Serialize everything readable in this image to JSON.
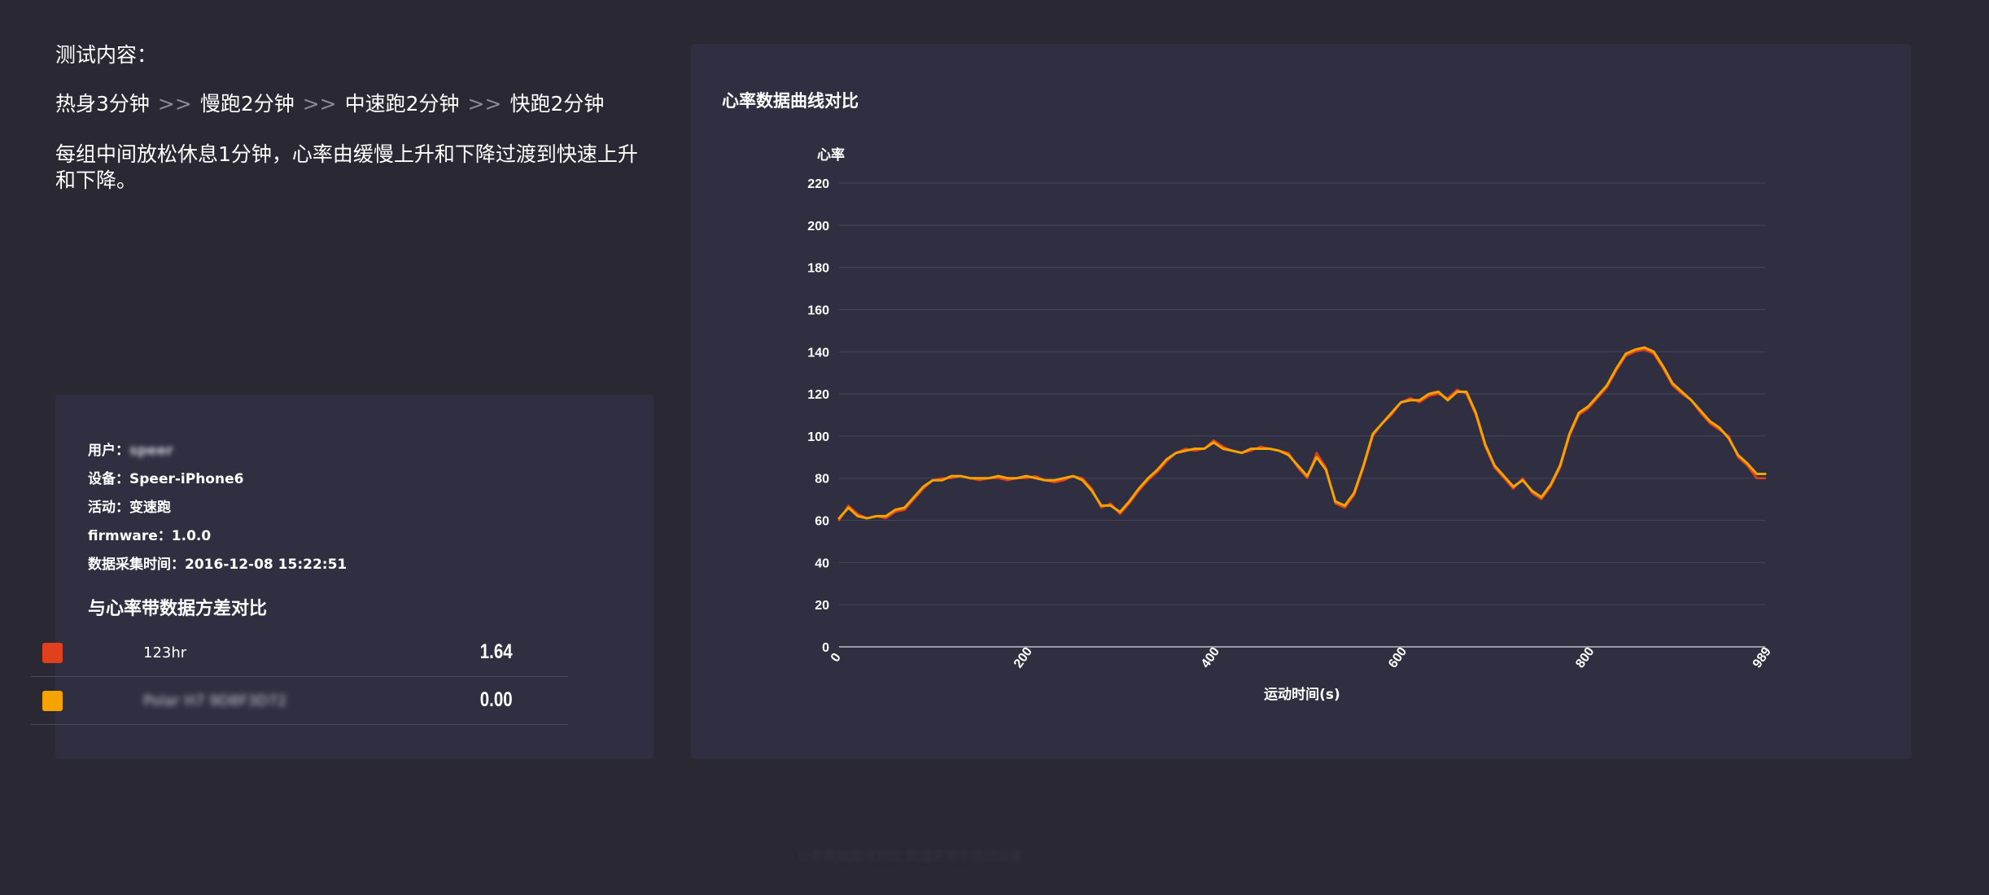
{
  "intro": {
    "title": "测试内容：",
    "steps": [
      "热身3分钟",
      "慢跑2分钟",
      "中速跑2分钟",
      "快跑2分钟"
    ],
    "separator": ">>",
    "description": "每组中间放松休息1分钟，心率由缓慢上升和下降过渡到快速上升和下降。"
  },
  "info": {
    "user_label": "用户：",
    "user_value": "speer",
    "device_label": "设备：",
    "device_value": "Speer-iPhone6",
    "activity_label": "活动：",
    "activity_value": "变速跑",
    "firmware_label": "firmware：",
    "firmware_value": "1.0.0",
    "time_label": "数据采集时间：",
    "time_value": "2016-12-08 15:22:51"
  },
  "comparison": {
    "title": "与心率带数据方差对比",
    "rows": [
      {
        "name": "123hr",
        "value": "1.64",
        "color": "#e0401c",
        "name_blurred": false
      },
      {
        "name": "Polar H7 9D8F3D72",
        "value": "0.00",
        "color": "#f5a300",
        "name_blurred": true
      }
    ]
  },
  "footer_text": "心率数据曲线对比 数据来源于测试设备",
  "chart_data": {
    "type": "line",
    "title": "心率数据曲线对比",
    "xlabel": "运动时间(s)",
    "ylabel": "心率",
    "xlim": [
      0,
      989
    ],
    "ylim": [
      0,
      220
    ],
    "x_ticks": [
      0,
      200,
      400,
      600,
      800,
      989
    ],
    "y_ticks": [
      0,
      20,
      40,
      60,
      80,
      100,
      120,
      140,
      160,
      180,
      200,
      220
    ],
    "grid": true,
    "legend": "none",
    "series": [
      {
        "name": "123hr",
        "color": "#e0401c",
        "x": [
          0,
          10,
          20,
          30,
          40,
          50,
          60,
          70,
          80,
          90,
          100,
          110,
          120,
          130,
          140,
          150,
          160,
          170,
          180,
          190,
          200,
          210,
          220,
          230,
          240,
          250,
          260,
          270,
          280,
          290,
          300,
          310,
          320,
          330,
          340,
          350,
          360,
          370,
          380,
          390,
          400,
          410,
          420,
          430,
          440,
          450,
          460,
          470,
          480,
          490,
          500,
          510,
          520,
          530,
          540,
          550,
          560,
          570,
          580,
          590,
          600,
          610,
          620,
          630,
          640,
          650,
          660,
          670,
          680,
          690,
          700,
          710,
          720,
          730,
          740,
          750,
          760,
          770,
          780,
          790,
          800,
          810,
          820,
          830,
          840,
          850,
          860,
          870,
          880,
          890,
          900,
          910,
          920,
          930,
          940,
          950,
          960,
          970,
          980,
          989
        ],
        "y": [
          60,
          67,
          63,
          61,
          62,
          61,
          64,
          65,
          70,
          75,
          79,
          80,
          80,
          81,
          80,
          79,
          80,
          80,
          79,
          80,
          80,
          81,
          79,
          78,
          79,
          81,
          80,
          75,
          66,
          68,
          63,
          68,
          74,
          79,
          83,
          88,
          92,
          94,
          93,
          94,
          98,
          95,
          93,
          92,
          93,
          95,
          94,
          93,
          92,
          85,
          80,
          92,
          85,
          68,
          66,
          72,
          85,
          100,
          106,
          110,
          116,
          118,
          116,
          119,
          120,
          118,
          122,
          120,
          110,
          95,
          85,
          80,
          75,
          80,
          73,
          70,
          76,
          85,
          100,
          110,
          113,
          118,
          123,
          131,
          138,
          140,
          141,
          139,
          132,
          124,
          120,
          117,
          111,
          106,
          103,
          100,
          90,
          86,
          80,
          80
        ]
      },
      {
        "name": "Polar H7 9D8F3D72",
        "color": "#f5a300",
        "x": [
          0,
          10,
          20,
          30,
          40,
          50,
          60,
          70,
          80,
          90,
          100,
          110,
          120,
          130,
          140,
          150,
          160,
          170,
          180,
          190,
          200,
          210,
          220,
          230,
          240,
          250,
          260,
          270,
          280,
          290,
          300,
          310,
          320,
          330,
          340,
          350,
          360,
          370,
          380,
          390,
          400,
          410,
          420,
          430,
          440,
          450,
          460,
          470,
          480,
          490,
          500,
          510,
          520,
          530,
          540,
          550,
          560,
          570,
          580,
          590,
          600,
          610,
          620,
          630,
          640,
          650,
          660,
          670,
          680,
          690,
          700,
          710,
          720,
          730,
          740,
          750,
          760,
          770,
          780,
          790,
          800,
          810,
          820,
          830,
          840,
          850,
          860,
          870,
          880,
          890,
          900,
          910,
          920,
          930,
          940,
          950,
          960,
          970,
          980,
          989
        ],
        "y": [
          61,
          66,
          62,
          61,
          62,
          62,
          65,
          66,
          71,
          76,
          79,
          79,
          81,
          81,
          80,
          80,
          80,
          81,
          80,
          80,
          81,
          80,
          79,
          79,
          80,
          81,
          79,
          74,
          67,
          67,
          64,
          69,
          75,
          80,
          84,
          89,
          92,
          93,
          94,
          94,
          97,
          94,
          93,
          92,
          94,
          94,
          94,
          93,
          91,
          86,
          81,
          90,
          84,
          69,
          67,
          73,
          86,
          101,
          106,
          111,
          116,
          117,
          117,
          120,
          121,
          117,
          121,
          121,
          111,
          96,
          86,
          81,
          76,
          79,
          74,
          71,
          77,
          86,
          101,
          111,
          114,
          119,
          124,
          132,
          139,
          141,
          142,
          140,
          133,
          125,
          121,
          117,
          112,
          107,
          104,
          99,
          91,
          87,
          82,
          82
        ]
      }
    ]
  }
}
